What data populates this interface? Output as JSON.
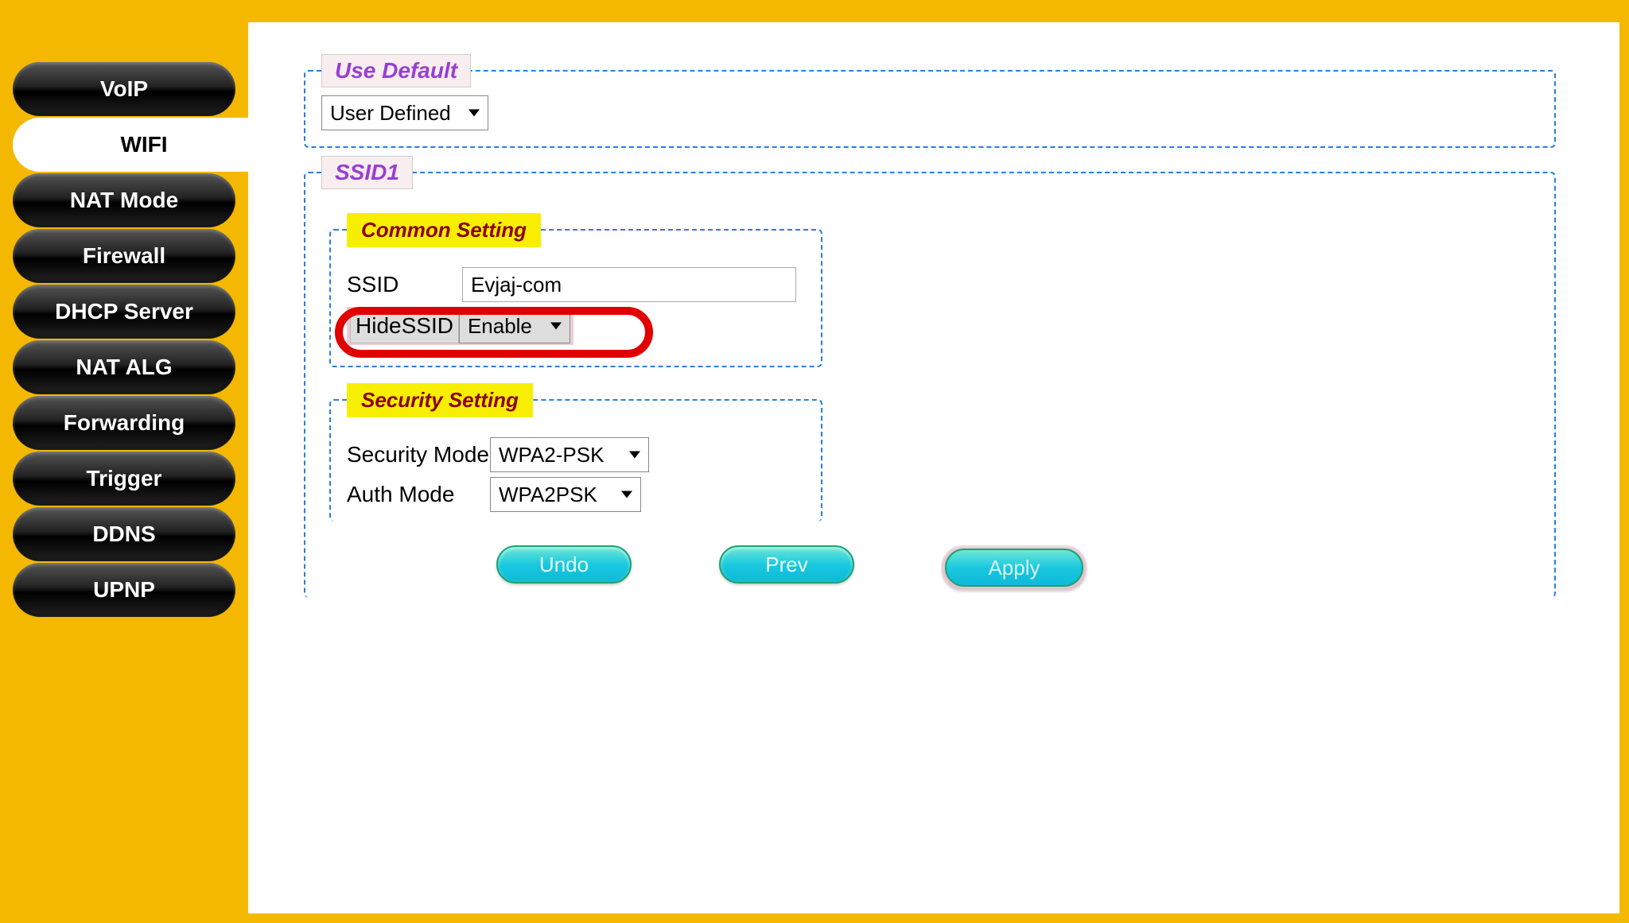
{
  "sidebar": {
    "items": [
      {
        "label": "VoIP"
      },
      {
        "label": "WIFI"
      },
      {
        "label": "NAT Mode"
      },
      {
        "label": "Firewall"
      },
      {
        "label": "DHCP Server"
      },
      {
        "label": "NAT ALG"
      },
      {
        "label": "Forwarding"
      },
      {
        "label": "Trigger"
      },
      {
        "label": "DDNS"
      },
      {
        "label": "UPNP"
      }
    ],
    "active_index": 1
  },
  "sections": {
    "use_default": {
      "legend": "Use Default",
      "profile_select": "User Defined"
    },
    "ssid1": {
      "legend": "SSID1",
      "common": {
        "legend": "Common Setting",
        "ssid_label": "SSID",
        "ssid_value": "Evjaj-com",
        "hide_ssid_label": "HideSSID",
        "hide_ssid_value": "Enable"
      },
      "security": {
        "legend": "Security Setting",
        "security_mode_label": "Security Mode",
        "security_mode_value": "WPA2-PSK",
        "auth_mode_label": "Auth Mode",
        "auth_mode_value": "WPA2PSK"
      }
    }
  },
  "buttons": {
    "undo": "Undo",
    "prev": "Prev",
    "apply": "Apply"
  }
}
